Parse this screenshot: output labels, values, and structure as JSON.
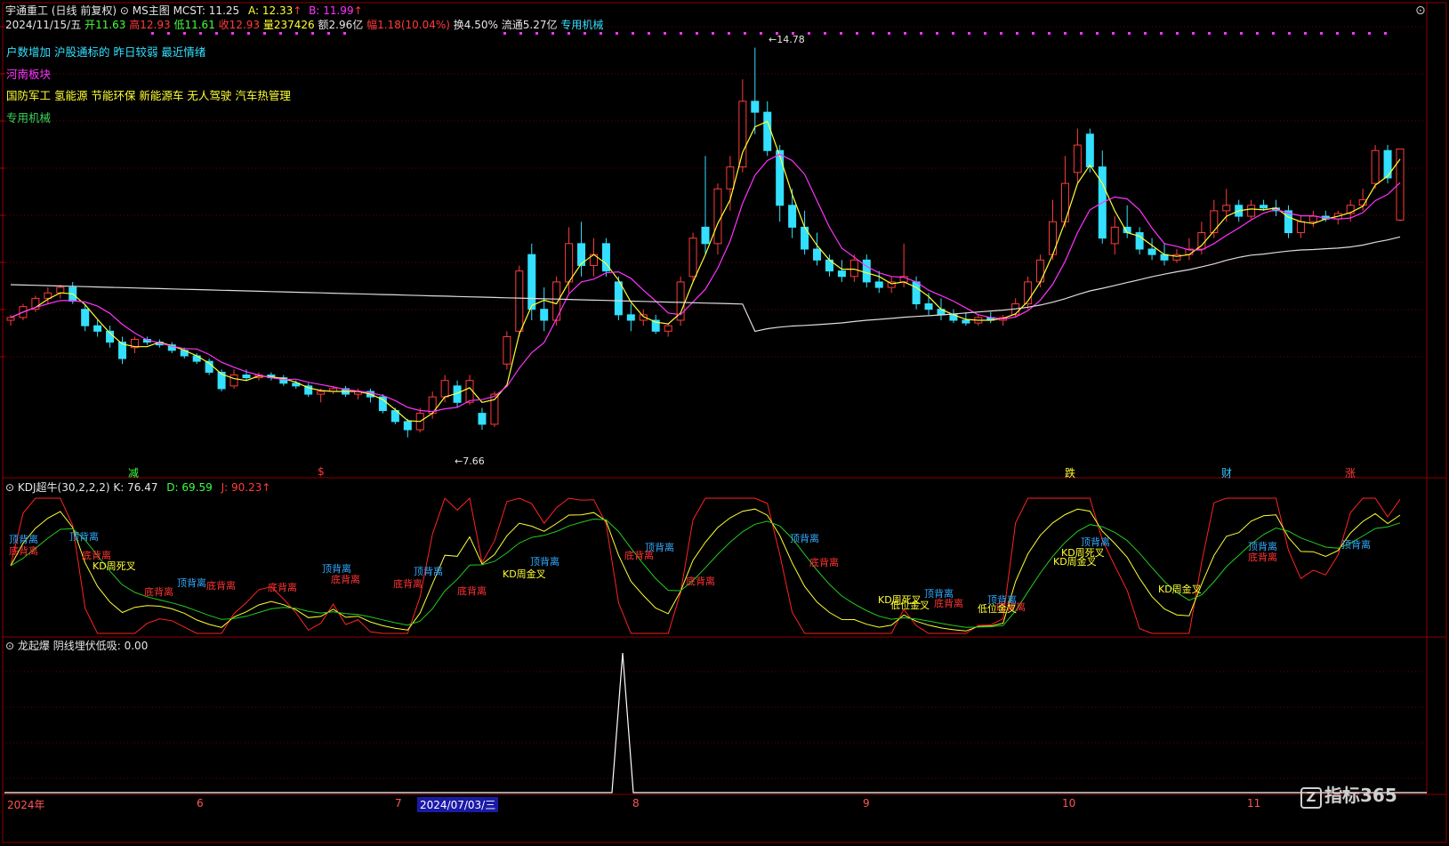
{
  "header": {
    "stock_name": "宇通重工",
    "period": "(日线 前复权)",
    "indicator_name": "MS主图",
    "mcst_label": "MCST:",
    "mcst_value": "11.25",
    "a_label": "A:",
    "a_value": "12.33",
    "b_label": "B:",
    "b_value": "11.99",
    "date": "2024/11/15/五",
    "open_label": "开",
    "open_value": "11.63",
    "high_label": "高",
    "high_value": "12.93",
    "low_label": "低",
    "low_value": "11.61",
    "close_label": "收",
    "close_value": "12.93",
    "volume_label": "量",
    "volume_value": "237426",
    "amount_label": "额",
    "amount_value": "2.96亿",
    "change_label": "幅",
    "change_value": "1.18(10.04%)",
    "turnover_label": "换",
    "turnover_value": "4.50%",
    "float_label": "流通",
    "float_value": "5.27亿",
    "industry": "专用机械"
  },
  "info_lines": {
    "line1": "户数增加 沪股通标的 昨日较弱 最近情绪",
    "line2": "河南板块",
    "line3": "国防军工 氢能源 节能环保 新能源车 无人驾驶 汽车热管理",
    "line4": "专用机械"
  },
  "price_marks": {
    "high": "14.78",
    "low": "7.66"
  },
  "event_marks": [
    {
      "text": "减",
      "color": "#3dff3d"
    },
    {
      "text": "$",
      "color": "#ff3b3b"
    },
    {
      "text": "跌",
      "color": "#ffff33"
    },
    {
      "text": "财",
      "color": "#33c8ff"
    },
    {
      "text": "涨",
      "color": "#ff3b3b"
    }
  ],
  "kdj": {
    "title": "KDJ超牛(30,2,2,2)",
    "k_label": "K:",
    "k_value": "76.47",
    "d_label": "D:",
    "d_value": "69.59",
    "j_label": "J:",
    "j_value": "90.23",
    "signals": [
      {
        "text": "顶背离",
        "color": "#33aaff"
      },
      {
        "text": "底背离",
        "color": "#ff3333"
      },
      {
        "text": "KD周死叉",
        "color": "#ffff33"
      },
      {
        "text": "KD周金叉",
        "color": "#ffff33"
      },
      {
        "text": "低位金叉",
        "color": "#ffff33"
      }
    ]
  },
  "lqb": {
    "title": "龙起爆",
    "series_label": "阴线埋伏低吸:",
    "series_value": "0.00"
  },
  "timeline": {
    "labels": [
      "2024年",
      "6",
      "7",
      "8",
      "9",
      "10",
      "11"
    ],
    "selected_date": "2024/07/03/三"
  },
  "logo": {
    "icon": "Z",
    "text": "指标365"
  },
  "colors": {
    "up": "#ff3b3b",
    "down": "#33e0ff",
    "ma_yellow": "#ffff33",
    "ma_magenta": "#ff33ff",
    "ma_white": "#dddddd",
    "grid": "#6a0000",
    "dots": "#ff33ff"
  },
  "chart_data": {
    "type": "candlestick",
    "ylim": [
      7.2,
      15.0
    ],
    "candles": [
      [
        9.8,
        9.9,
        9.7,
        9.85
      ],
      [
        9.85,
        10.1,
        9.8,
        10.05
      ],
      [
        10.0,
        10.25,
        9.95,
        10.2
      ],
      [
        10.2,
        10.4,
        10.1,
        10.3
      ],
      [
        10.3,
        10.45,
        10.2,
        10.4
      ],
      [
        10.4,
        10.5,
        10.1,
        10.15
      ],
      [
        10.0,
        10.1,
        9.6,
        9.7
      ],
      [
        9.7,
        9.8,
        9.5,
        9.6
      ],
      [
        9.6,
        9.7,
        9.3,
        9.4
      ],
      [
        9.4,
        9.5,
        9.0,
        9.1
      ],
      [
        9.3,
        9.5,
        9.2,
        9.45
      ],
      [
        9.45,
        9.5,
        9.35,
        9.4
      ],
      [
        9.4,
        9.45,
        9.3,
        9.35
      ],
      [
        9.35,
        9.4,
        9.2,
        9.25
      ],
      [
        9.25,
        9.3,
        9.1,
        9.15
      ],
      [
        9.15,
        9.2,
        9.0,
        9.05
      ],
      [
        9.05,
        9.1,
        8.8,
        8.85
      ],
      [
        8.85,
        8.9,
        8.5,
        8.55
      ],
      [
        8.6,
        8.9,
        8.55,
        8.8
      ],
      [
        8.8,
        8.9,
        8.7,
        8.75
      ],
      [
        8.75,
        8.85,
        8.7,
        8.8
      ],
      [
        8.8,
        8.85,
        8.7,
        8.75
      ],
      [
        8.75,
        8.8,
        8.6,
        8.65
      ],
      [
        8.65,
        8.7,
        8.55,
        8.6
      ],
      [
        8.6,
        8.65,
        8.4,
        8.45
      ],
      [
        8.45,
        8.55,
        8.3,
        8.5
      ],
      [
        8.5,
        8.6,
        8.45,
        8.55
      ],
      [
        8.55,
        8.6,
        8.4,
        8.45
      ],
      [
        8.45,
        8.55,
        8.35,
        8.5
      ],
      [
        8.5,
        8.55,
        8.3,
        8.4
      ],
      [
        8.4,
        8.45,
        8.1,
        8.15
      ],
      [
        8.15,
        8.2,
        7.9,
        7.95
      ],
      [
        7.95,
        8.0,
        7.66,
        7.8
      ],
      [
        7.8,
        8.2,
        7.75,
        8.1
      ],
      [
        8.1,
        8.5,
        8.0,
        8.4
      ],
      [
        8.4,
        8.8,
        8.3,
        8.7
      ],
      [
        8.6,
        8.7,
        8.2,
        8.3
      ],
      [
        8.3,
        8.8,
        8.25,
        8.7
      ],
      [
        8.1,
        8.2,
        7.8,
        7.9
      ],
      [
        7.9,
        8.5,
        7.85,
        8.45
      ],
      [
        9.0,
        9.6,
        8.9,
        9.5
      ],
      [
        9.6,
        10.8,
        9.5,
        10.7
      ],
      [
        11.0,
        11.2,
        9.8,
        10.0
      ],
      [
        10.0,
        10.4,
        9.6,
        9.8
      ],
      [
        9.8,
        10.6,
        9.7,
        10.5
      ],
      [
        10.5,
        11.5,
        10.3,
        11.2
      ],
      [
        11.2,
        11.6,
        10.6,
        10.8
      ],
      [
        10.8,
        11.3,
        10.6,
        11.0
      ],
      [
        11.2,
        11.3,
        10.6,
        10.7
      ],
      [
        10.5,
        10.6,
        9.8,
        9.9
      ],
      [
        9.9,
        10.1,
        9.6,
        9.8
      ],
      [
        9.8,
        10.0,
        9.7,
        9.9
      ],
      [
        9.8,
        9.9,
        9.55,
        9.6
      ],
      [
        9.6,
        9.75,
        9.5,
        9.7
      ],
      [
        9.8,
        10.6,
        9.7,
        10.5
      ],
      [
        10.6,
        11.4,
        10.5,
        11.3
      ],
      [
        11.5,
        12.8,
        11.0,
        11.2
      ],
      [
        11.2,
        12.3,
        11.0,
        12.2
      ],
      [
        12.2,
        12.8,
        11.8,
        12.6
      ],
      [
        12.6,
        14.2,
        12.5,
        13.8
      ],
      [
        13.8,
        14.78,
        13.2,
        13.6
      ],
      [
        13.6,
        13.8,
        12.8,
        12.9
      ],
      [
        12.9,
        13.0,
        11.6,
        11.9
      ],
      [
        11.9,
        12.2,
        11.3,
        11.5
      ],
      [
        11.5,
        11.8,
        11.0,
        11.1
      ],
      [
        11.1,
        11.4,
        10.8,
        10.9
      ],
      [
        10.9,
        11.0,
        10.6,
        10.7
      ],
      [
        10.7,
        10.9,
        10.5,
        10.6
      ],
      [
        10.6,
        11.0,
        10.5,
        10.9
      ],
      [
        10.9,
        11.0,
        10.4,
        10.5
      ],
      [
        10.5,
        10.7,
        10.3,
        10.4
      ],
      [
        10.4,
        10.6,
        10.3,
        10.5
      ],
      [
        10.5,
        11.2,
        10.4,
        10.6
      ],
      [
        10.5,
        10.6,
        10.0,
        10.1
      ],
      [
        10.1,
        10.3,
        9.9,
        10.0
      ],
      [
        10.0,
        10.2,
        9.8,
        9.9
      ],
      [
        9.9,
        10.0,
        9.75,
        9.8
      ],
      [
        9.8,
        9.95,
        9.7,
        9.75
      ],
      [
        9.75,
        9.9,
        9.7,
        9.85
      ],
      [
        9.85,
        9.95,
        9.75,
        9.8
      ],
      [
        9.8,
        9.9,
        9.7,
        9.85
      ],
      [
        9.9,
        10.2,
        9.85,
        10.1
      ],
      [
        10.1,
        10.6,
        10.0,
        10.5
      ],
      [
        10.5,
        11.0,
        10.4,
        10.9
      ],
      [
        11.0,
        12.0,
        10.9,
        11.6
      ],
      [
        11.6,
        12.8,
        11.5,
        12.3
      ],
      [
        12.5,
        13.3,
        12.3,
        13.0
      ],
      [
        13.2,
        13.3,
        12.5,
        12.6
      ],
      [
        12.6,
        12.9,
        11.2,
        11.3
      ],
      [
        11.2,
        11.7,
        11.0,
        11.5
      ],
      [
        11.5,
        11.9,
        11.3,
        11.4
      ],
      [
        11.4,
        11.5,
        11.0,
        11.1
      ],
      [
        11.1,
        11.3,
        10.9,
        11.0
      ],
      [
        11.0,
        11.2,
        10.8,
        10.9
      ],
      [
        10.9,
        11.1,
        10.85,
        11.0
      ],
      [
        11.0,
        11.3,
        10.9,
        11.1
      ],
      [
        11.1,
        11.6,
        11.0,
        11.4
      ],
      [
        11.4,
        12.0,
        11.3,
        11.8
      ],
      [
        11.8,
        12.2,
        11.6,
        11.9
      ],
      [
        11.9,
        12.0,
        11.6,
        11.7
      ],
      [
        11.7,
        12.0,
        11.65,
        11.9
      ],
      [
        11.9,
        12.0,
        11.8,
        11.85
      ],
      [
        11.85,
        12.0,
        11.7,
        11.8
      ],
      [
        11.8,
        11.9,
        11.3,
        11.4
      ],
      [
        11.4,
        11.7,
        11.3,
        11.6
      ],
      [
        11.6,
        11.8,
        11.5,
        11.7
      ],
      [
        11.7,
        11.8,
        11.6,
        11.65
      ],
      [
        11.65,
        11.8,
        11.55,
        11.75
      ],
      [
        11.75,
        12.0,
        11.6,
        11.9
      ],
      [
        11.9,
        12.2,
        11.8,
        12.0
      ],
      [
        12.3,
        13.0,
        12.2,
        12.9
      ],
      [
        12.9,
        13.0,
        12.3,
        12.4
      ],
      [
        11.63,
        12.93,
        11.61,
        12.93
      ]
    ]
  }
}
